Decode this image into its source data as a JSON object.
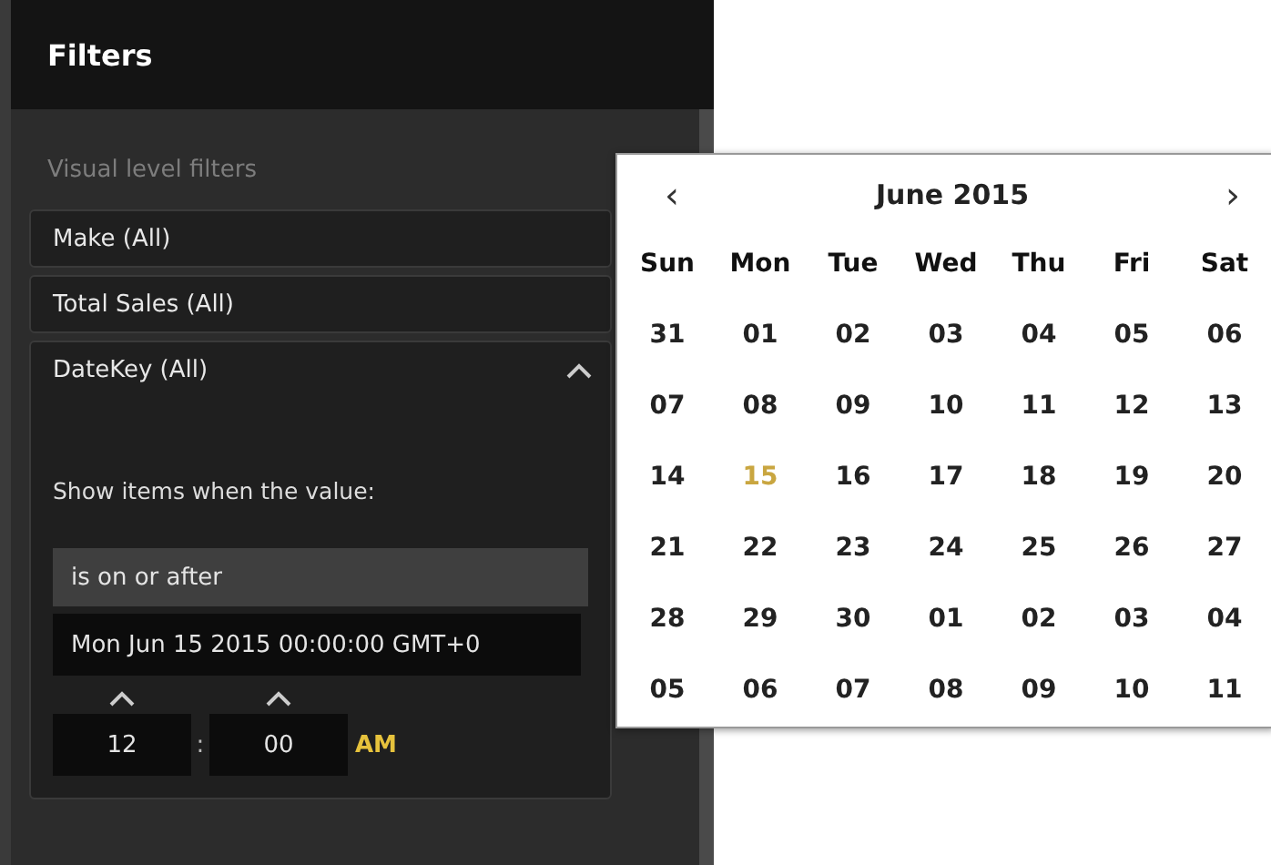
{
  "panel": {
    "title": "Filters",
    "section": "Visual level filters",
    "filters": [
      {
        "label": "Make (All)",
        "expanded": false
      },
      {
        "label": "Total Sales (All)",
        "expanded": false
      },
      {
        "label": "DateKey (All)",
        "expanded": true
      }
    ],
    "condition_label": "Show items when the value:",
    "operator": "is on or after",
    "date_value": "Mon Jun 15 2015 00:00:00 GMT+0",
    "time": {
      "hour": "12",
      "separator": ":",
      "minute": "00",
      "period": "AM"
    }
  },
  "calendar": {
    "prev": "‹",
    "month": "June 2015",
    "next": "›",
    "weekdays": [
      "Sun",
      "Mon",
      "Tue",
      "Wed",
      "Thu",
      "Fri",
      "Sat"
    ],
    "weeks": [
      [
        {
          "label": "31",
          "selected": false
        },
        {
          "label": "01",
          "selected": false
        },
        {
          "label": "02",
          "selected": false
        },
        {
          "label": "03",
          "selected": false
        },
        {
          "label": "04",
          "selected": false
        },
        {
          "label": "05",
          "selected": false
        },
        {
          "label": "06",
          "selected": false
        }
      ],
      [
        {
          "label": "07",
          "selected": false
        },
        {
          "label": "08",
          "selected": false
        },
        {
          "label": "09",
          "selected": false
        },
        {
          "label": "10",
          "selected": false
        },
        {
          "label": "11",
          "selected": false
        },
        {
          "label": "12",
          "selected": false
        },
        {
          "label": "13",
          "selected": false
        }
      ],
      [
        {
          "label": "14",
          "selected": false
        },
        {
          "label": "15",
          "selected": true
        },
        {
          "label": "16",
          "selected": false
        },
        {
          "label": "17",
          "selected": false
        },
        {
          "label": "18",
          "selected": false
        },
        {
          "label": "19",
          "selected": false
        },
        {
          "label": "20",
          "selected": false
        }
      ],
      [
        {
          "label": "21",
          "selected": false
        },
        {
          "label": "22",
          "selected": false
        },
        {
          "label": "23",
          "selected": false
        },
        {
          "label": "24",
          "selected": false
        },
        {
          "label": "25",
          "selected": false
        },
        {
          "label": "26",
          "selected": false
        },
        {
          "label": "27",
          "selected": false
        }
      ],
      [
        {
          "label": "28",
          "selected": false
        },
        {
          "label": "29",
          "selected": false
        },
        {
          "label": "30",
          "selected": false
        },
        {
          "label": "01",
          "selected": false
        },
        {
          "label": "02",
          "selected": false
        },
        {
          "label": "03",
          "selected": false
        },
        {
          "label": "04",
          "selected": false
        }
      ],
      [
        {
          "label": "05",
          "selected": false
        },
        {
          "label": "06",
          "selected": false
        },
        {
          "label": "07",
          "selected": false
        },
        {
          "label": "08",
          "selected": false
        },
        {
          "label": "09",
          "selected": false
        },
        {
          "label": "10",
          "selected": false
        },
        {
          "label": "11",
          "selected": false
        }
      ]
    ]
  }
}
